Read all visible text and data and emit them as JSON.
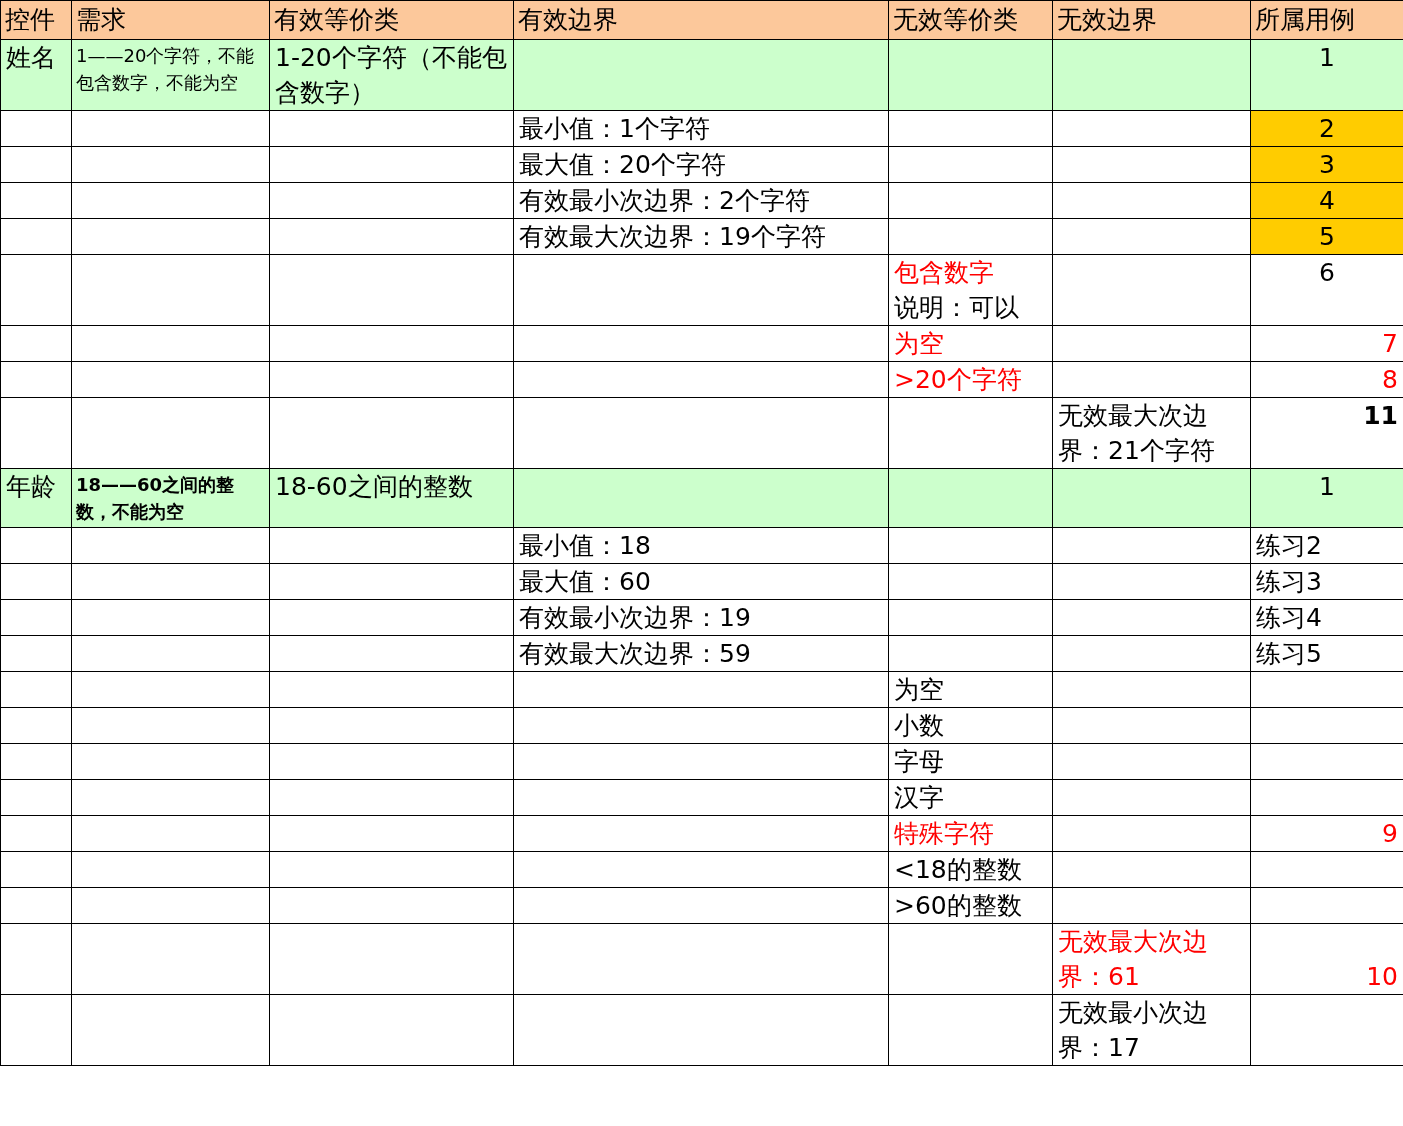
{
  "table": {
    "columns": [
      "控件",
      "需求",
      "有效等价类",
      "有效边界",
      "无效等价类",
      "无效边界",
      "所属用例"
    ],
    "rows": [
      {
        "highlighted": true,
        "cells": [
          {
            "text": "姓名"
          },
          {
            "text": "1——20个字符，不能包含数字，不能为空",
            "kind": "note"
          },
          {
            "text": "1-20个字符（不能包含数字）"
          },
          null,
          null,
          null,
          {
            "text": "1",
            "kind": "centered"
          }
        ]
      },
      {
        "highlighted": false,
        "cells": [
          null,
          null,
          null,
          {
            "text": "最小值：1个字符"
          },
          null,
          null,
          {
            "text": "2",
            "kind": "centered",
            "highlighted": true
          }
        ]
      },
      {
        "highlighted": false,
        "cells": [
          null,
          null,
          null,
          {
            "text": "最大值：20个字符"
          },
          null,
          null,
          {
            "text": "3",
            "kind": "centered",
            "highlighted": true
          }
        ]
      },
      {
        "highlighted": false,
        "cells": [
          null,
          null,
          null,
          {
            "text": "有效最小次边界：2个字符"
          },
          null,
          null,
          {
            "text": "4",
            "kind": "centered",
            "highlighted": true
          }
        ]
      },
      {
        "highlighted": false,
        "cells": [
          null,
          null,
          null,
          {
            "text": "有效最大次边界：19个字符"
          },
          null,
          null,
          {
            "text": "5",
            "kind": "centered",
            "highlighted": true
          }
        ]
      },
      {
        "highlighted": false,
        "cells": [
          null,
          null,
          null,
          null,
          {
            "text": "包含数字",
            "color": "#ff0000",
            "note": "说明：可以"
          },
          null,
          {
            "text": "6",
            "kind": "centered"
          }
        ]
      },
      {
        "highlighted": false,
        "cells": [
          null,
          null,
          null,
          null,
          {
            "text": "为空",
            "color": "#ff0000"
          },
          null,
          {
            "text": "7",
            "kind": "count",
            "color": "#ff0000"
          }
        ]
      },
      {
        "highlighted": false,
        "cells": [
          null,
          null,
          null,
          null,
          {
            "text": ">20个字符",
            "color": "#ff0000"
          },
          null,
          {
            "text": "8",
            "kind": "count",
            "color": "#ff0000"
          }
        ]
      },
      {
        "highlighted": false,
        "cells": [
          null,
          null,
          null,
          null,
          null,
          {
            "text": "无效最大次边界：21个字符"
          },
          {
            "text": "11",
            "kind": "count",
            "bold": true
          }
        ]
      },
      {
        "highlighted": true,
        "cells": [
          {
            "text": "年龄"
          },
          {
            "text": "18——60之间的整数，不能为空",
            "bold": true,
            "kind": "note"
          },
          {
            "text": "18-60之间的整数"
          },
          null,
          null,
          null,
          {
            "text": "1",
            "kind": "centered"
          }
        ]
      },
      {
        "highlighted": false,
        "cells": [
          null,
          null,
          null,
          {
            "text": "最小值：18"
          },
          null,
          null,
          {
            "text": "练习2"
          }
        ]
      },
      {
        "highlighted": false,
        "cells": [
          null,
          null,
          null,
          {
            "text": "最大值：60"
          },
          null,
          null,
          {
            "text": "练习3"
          }
        ]
      },
      {
        "highlighted": false,
        "cells": [
          null,
          null,
          null,
          {
            "text": "有效最小次边界：19"
          },
          null,
          null,
          {
            "text": "练习4"
          }
        ]
      },
      {
        "highlighted": false,
        "cells": [
          null,
          null,
          null,
          {
            "text": "有效最大次边界：59"
          },
          null,
          null,
          {
            "text": "练习5"
          }
        ]
      },
      {
        "highlighted": false,
        "cells": [
          null,
          null,
          null,
          null,
          {
            "text": "为空"
          },
          null,
          null
        ]
      },
      {
        "highlighted": false,
        "cells": [
          null,
          null,
          null,
          null,
          {
            "text": "小数"
          },
          null,
          null
        ]
      },
      {
        "highlighted": false,
        "cells": [
          null,
          null,
          null,
          null,
          {
            "text": "字母"
          },
          null,
          null
        ]
      },
      {
        "highlighted": false,
        "cells": [
          null,
          null,
          null,
          null,
          {
            "text": "汉字"
          },
          null,
          null
        ]
      },
      {
        "highlighted": false,
        "cells": [
          null,
          null,
          null,
          null,
          {
            "text": "特殊字符",
            "color": "#ff0000"
          },
          null,
          {
            "text": "9",
            "kind": "count",
            "color": "#ff0000"
          }
        ]
      },
      {
        "highlighted": false,
        "cells": [
          null,
          null,
          null,
          null,
          {
            "text": "<18的整数"
          },
          null,
          null
        ]
      },
      {
        "highlighted": false,
        "cells": [
          null,
          null,
          null,
          null,
          {
            "text": ">60的整数"
          },
          null,
          null
        ]
      },
      {
        "highlighted": false,
        "cells": [
          null,
          null,
          null,
          null,
          null,
          {
            "text": "无效最大次边界：61",
            "color": "#ff0000"
          },
          {
            "text": "10",
            "kind": "footnumber",
            "color": "#ff0000"
          }
        ]
      },
      {
        "highlighted": false,
        "cells": [
          null,
          null,
          null,
          null,
          null,
          {
            "text": "无效最小次边界：17"
          },
          null
        ]
      }
    ]
  }
}
